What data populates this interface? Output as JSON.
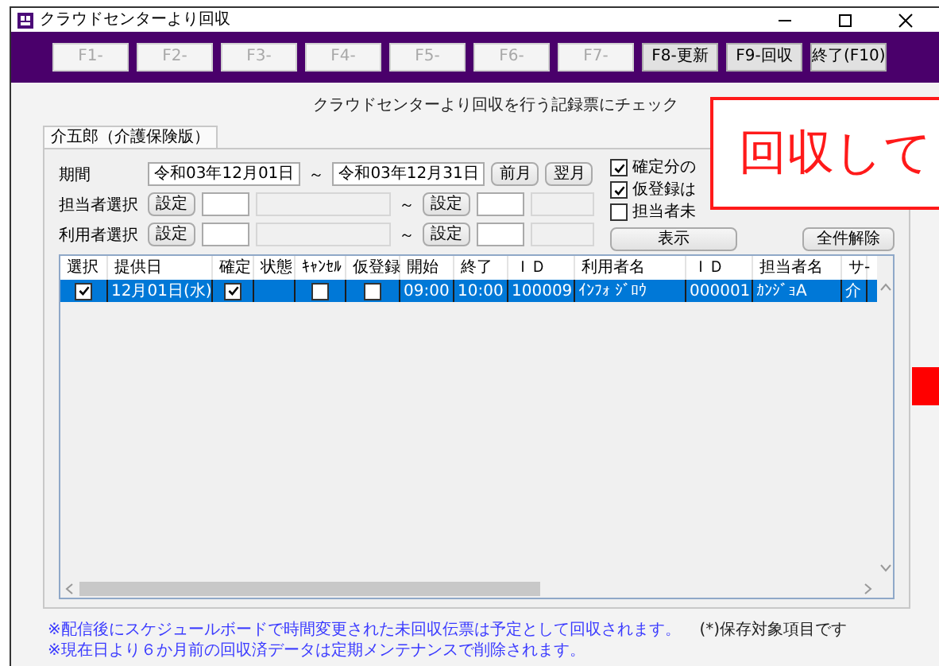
{
  "window": {
    "title": "クラウドセンターより回収"
  },
  "function_keys": [
    {
      "label": "F1-",
      "disabled": true
    },
    {
      "label": "F2-",
      "disabled": true
    },
    {
      "label": "F3-",
      "disabled": true
    },
    {
      "label": "F4-",
      "disabled": true
    },
    {
      "label": "F5-",
      "disabled": true
    },
    {
      "label": "F6-",
      "disabled": true
    },
    {
      "label": "F7-",
      "disabled": true
    },
    {
      "label": "F8-更新",
      "disabled": false
    },
    {
      "label": "F9-回収",
      "disabled": false
    },
    {
      "label": "終了(F10)",
      "disabled": false
    }
  ],
  "instruction": "クラウドセンターより回収を行う記録票にチェック",
  "tabs": [
    {
      "label": "介五郎（介護保険版）",
      "selected": true
    }
  ],
  "period": {
    "label": "期間",
    "from": "令和03年12月01日",
    "separator": "～",
    "to": "令和03年12月31日",
    "buttons": [
      "前月",
      "翌月"
    ]
  },
  "selectors": [
    {
      "label": "担当者選択",
      "from_button": "設定",
      "separator": "～",
      "to_button": "設定"
    },
    {
      "label": "利用者選択",
      "from_button": "設定",
      "separator": "～",
      "to_button": "設定"
    }
  ],
  "options": [
    {
      "label": "確定分の",
      "checked": true
    },
    {
      "label": "仮登録は",
      "checked": true
    },
    {
      "label": "担当者未",
      "checked": false
    }
  ],
  "show_button": "表示",
  "clear_all_button": "全件解除",
  "table": {
    "columns": [
      "選択",
      "提供日",
      "確定",
      "状態",
      "ｷｬﾝｾﾙ",
      "仮登録",
      "開始",
      "終了",
      "ＩＤ",
      "利用者名",
      "ＩＤ",
      "担当者名",
      "サ-"
    ],
    "rows": [
      {
        "selected": true,
        "cells": [
          {
            "kind": "check",
            "checked": true
          },
          {
            "kind": "text",
            "text": "12月01日(水)"
          },
          {
            "kind": "check",
            "checked": true
          },
          {
            "kind": "empty"
          },
          {
            "kind": "check",
            "checked": false
          },
          {
            "kind": "check",
            "checked": false
          },
          {
            "kind": "text",
            "text": "09:00"
          },
          {
            "kind": "text",
            "text": "10:00"
          },
          {
            "kind": "text",
            "text": "100009"
          },
          {
            "kind": "text",
            "text": "ｲﾝﾌｫ ｼﾞﾛｳ"
          },
          {
            "kind": "text",
            "text": "000001"
          },
          {
            "kind": "text",
            "text": "ｶﾝｼﾞｮA"
          },
          {
            "kind": "text",
            "text": "介"
          }
        ]
      }
    ]
  },
  "notes": [
    "※配信後にスケジュールボードで時間変更された未回収伝票は予定として回収されます。",
    "※現在日より６か月前の回収済データは定期メンテナンスで削除されます。"
  ],
  "legend": "(*)保存対象項目です",
  "callout": {
    "text": "回収して"
  }
}
